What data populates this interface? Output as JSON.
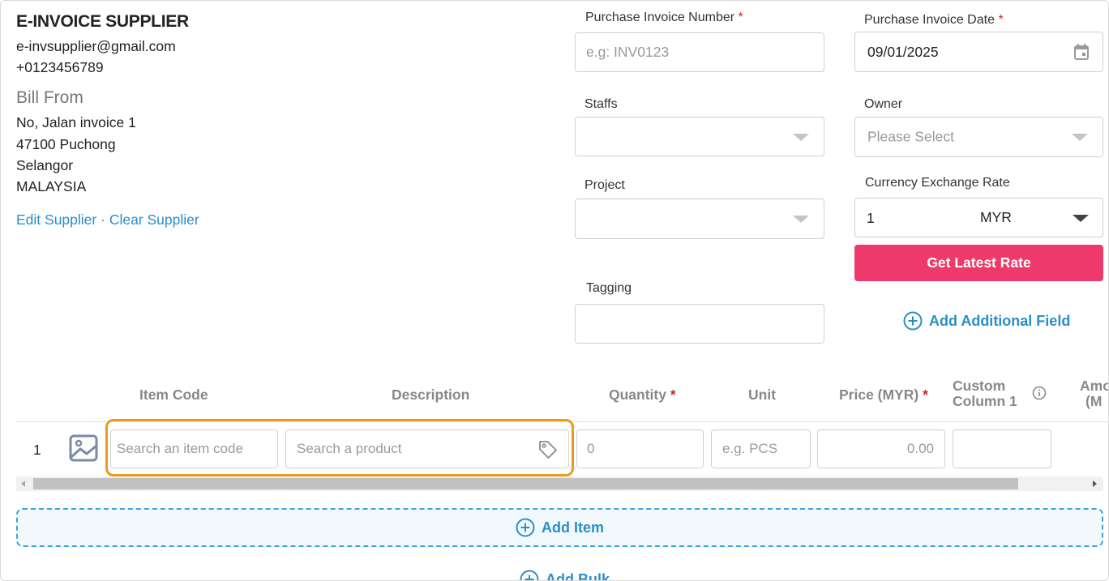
{
  "supplier": {
    "name": "E-INVOICE SUPPLIER",
    "email": "e-invsupplier@gmail.com",
    "phone": "+0123456789",
    "bill_from_label": "Bill From",
    "address": [
      "No, Jalan invoice 1",
      "47100 Puchong",
      "Selangor",
      "MALAYSIA"
    ],
    "edit_label": "Edit Supplier",
    "separator": "·",
    "clear_label": "Clear Supplier"
  },
  "form": {
    "invoice_number": {
      "label": "Purchase Invoice Number",
      "required": "*",
      "placeholder": "e.g: INV0123",
      "value": ""
    },
    "invoice_date": {
      "label": "Purchase Invoice Date",
      "required": "*",
      "value": "09/01/2025",
      "icon": "calendar-icon"
    },
    "staffs": {
      "label": "Staffs",
      "value": ""
    },
    "owner": {
      "label": "Owner",
      "placeholder": "Please Select"
    },
    "project": {
      "label": "Project",
      "value": ""
    },
    "currency": {
      "label": "Currency Exchange Rate",
      "rate": "1",
      "code": "MYR"
    },
    "get_rate_label": "Get Latest Rate",
    "tagging": {
      "label": "Tagging",
      "value": ""
    },
    "add_field_label": "Add Additional Field"
  },
  "table": {
    "headers": {
      "item_code": "Item Code",
      "description": "Description",
      "quantity": "Quantity",
      "quantity_req": "*",
      "unit": "Unit",
      "price": "Price (MYR)",
      "price_req": "*",
      "custom1_a": "Custom",
      "custom1_b": "Column 1",
      "amount_a": "Amo",
      "amount_b": "(M"
    },
    "row": {
      "number": "1",
      "item_code_placeholder": "Search an item code",
      "description_placeholder": "Search a product",
      "quantity_placeholder": "0",
      "unit_placeholder": "e.g. PCS",
      "price_placeholder": "0.00"
    },
    "add_item_label": "Add Item",
    "add_bulk_label": "Add Bulk"
  },
  "colors": {
    "accent": "#2a8ec7",
    "primary_button": "#ee3a6a",
    "highlight": "#ee9a1c",
    "required": "#c62828"
  }
}
